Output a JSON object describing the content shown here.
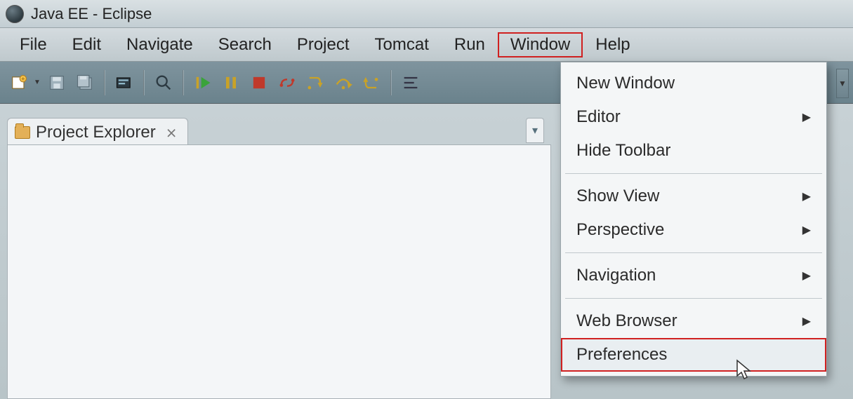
{
  "window": {
    "title": "Java EE - Eclipse"
  },
  "menubar": {
    "items": [
      "File",
      "Edit",
      "Navigate",
      "Search",
      "Project",
      "Tomcat",
      "Run",
      "Window",
      "Help"
    ],
    "highlighted": "Window"
  },
  "toolbar": {
    "buttons": [
      "new",
      "new-drop",
      "save",
      "save-all",
      "sep",
      "open-type",
      "sep",
      "search-mag",
      "sep",
      "resume",
      "suspend",
      "terminate",
      "disconnect",
      "step-into",
      "step-over",
      "step-return",
      "sep",
      "align"
    ]
  },
  "panel": {
    "tab_label": "Project Explorer",
    "close_glyph": "⨯"
  },
  "window_menu": {
    "items": [
      {
        "label": "New Window",
        "submenu": false
      },
      {
        "label": "Editor",
        "submenu": true
      },
      {
        "label": "Hide Toolbar",
        "submenu": false
      },
      {
        "sep": true
      },
      {
        "label": "Show View",
        "submenu": true
      },
      {
        "label": "Perspective",
        "submenu": true
      },
      {
        "sep": true
      },
      {
        "label": "Navigation",
        "submenu": true
      },
      {
        "sep": true
      },
      {
        "label": "Web Browser",
        "submenu": true
      },
      {
        "label": "Preferences",
        "submenu": false,
        "highlight": true
      }
    ]
  }
}
